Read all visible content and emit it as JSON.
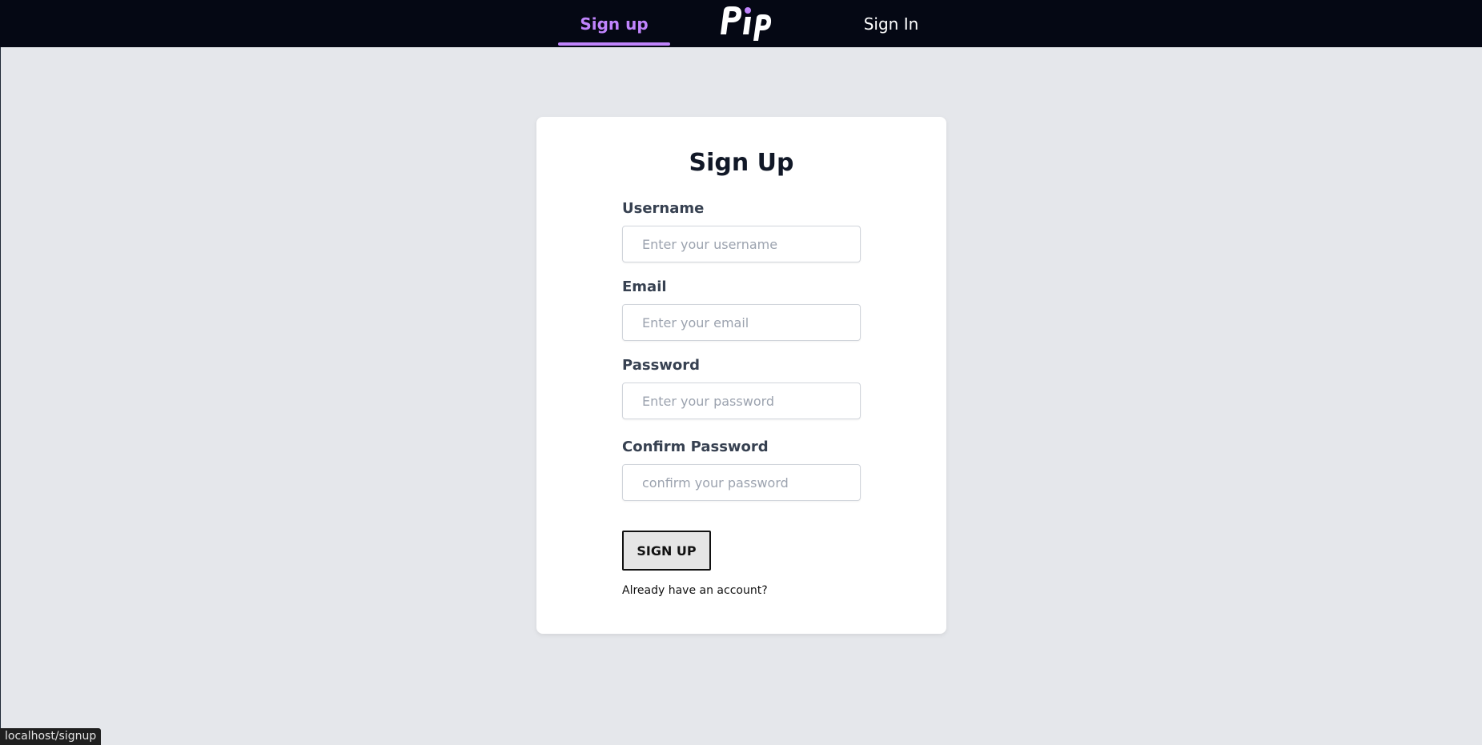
{
  "nav": {
    "signup_label": "Sign up",
    "signin_label": "Sign In",
    "logo_text": "Pip",
    "active_color": "#c084fc",
    "background_color": "#050814"
  },
  "form": {
    "title": "Sign Up",
    "username": {
      "label": "Username",
      "placeholder": "Enter your username",
      "value": ""
    },
    "email": {
      "label": "Email",
      "placeholder": "Enter your email",
      "value": ""
    },
    "password": {
      "label": "Password",
      "placeholder": "Enter your password",
      "value": ""
    },
    "confirm_password": {
      "label": "Confirm Password",
      "placeholder": "confirm your password",
      "value": ""
    },
    "submit_label": "SIGN UP",
    "signin_prompt": "Already have an account?"
  },
  "status_bar": {
    "url": "localhost/signup"
  }
}
